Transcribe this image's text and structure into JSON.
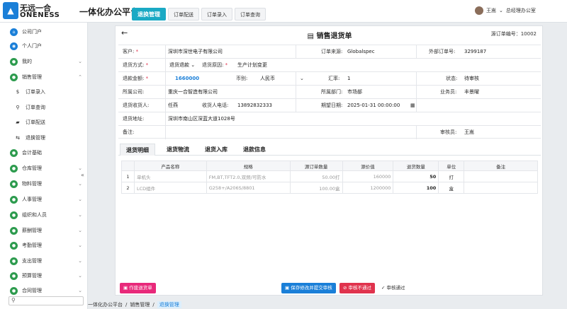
{
  "header": {
    "logo_text": "无远一合",
    "logo_sub": "ONENESS",
    "app_title": "一体化办公平台",
    "tabs": [
      {
        "label": "退换管理",
        "active": true
      },
      {
        "label": "订单配送",
        "active": false
      },
      {
        "label": "订单录入",
        "active": false
      },
      {
        "label": "订单查询",
        "active": false
      }
    ],
    "user_name": "王嵩",
    "user_dept": "总经理办公室"
  },
  "sidebar": {
    "items": [
      {
        "label": "公司门户",
        "icon": "portal-icon"
      },
      {
        "label": "个人门户",
        "icon": "wifi-icon"
      },
      {
        "label": "我的",
        "icon": "location-icon"
      },
      {
        "label": "销售管理",
        "icon": "sales-icon"
      },
      {
        "label": "会计基础",
        "icon": "accounting-icon"
      },
      {
        "label": "仓库管理",
        "icon": "warehouse-icon"
      },
      {
        "label": "物料管理",
        "icon": "material-icon"
      },
      {
        "label": "人事管理",
        "icon": "hr-icon"
      },
      {
        "label": "组织和人员",
        "icon": "org-icon"
      },
      {
        "label": "薪酬管理",
        "icon": "salary-icon"
      },
      {
        "label": "考勤管理",
        "icon": "attendance-icon"
      },
      {
        "label": "支出管理",
        "icon": "expense-icon"
      },
      {
        "label": "预算管理",
        "icon": "budget-icon"
      },
      {
        "label": "合同管理",
        "icon": "contract-icon"
      }
    ],
    "subitems": [
      {
        "label": "订单录入",
        "icon": "dollar-icon"
      },
      {
        "label": "订单查询",
        "icon": "search-icon"
      },
      {
        "label": "订单配送",
        "icon": "truck-icon"
      },
      {
        "label": "退换管理",
        "icon": "exchange-icon"
      }
    ]
  },
  "form": {
    "title": "销售退货单",
    "source_no_label": "源订单编号：",
    "source_no": "10002",
    "customer_label": "客户:",
    "customer": "深圳市深世电子有限公司",
    "order_source_label": "订单来源:",
    "order_source": "Globalspec",
    "ext_order_label": "外部订单号:",
    "ext_order": "3299187",
    "return_method_label": "退货方式:",
    "return_method": "退货退款",
    "return_reason_label": "退货原因:",
    "return_reason": "生产计划变更",
    "refund_label": "退款金额:",
    "refund": "1660000",
    "currency_label": "币别:",
    "currency": "人民币",
    "rate_label": "汇率:",
    "rate": "1",
    "status_label": "状态:",
    "status": "待审核",
    "company_label": "所属公司:",
    "company": "重庆一合智造有限公司",
    "dept_label": "所属部门:",
    "dept": "市场部",
    "salesman_label": "业务员:",
    "salesman": "丰景曜",
    "receiver_label": "退货收货人:",
    "receiver": "任燕",
    "receiver_phone_label": "收货人电话:",
    "receiver_phone": "13892832333",
    "expected_date_label": "期望日期:",
    "expected_date": "2025-01-31 00:00:00",
    "address_label": "退货地址:",
    "address": "深圳市南山区深蓝大道1028号",
    "remark_label": "备注:",
    "auditor_label": "审核员:",
    "auditor": "王嵩"
  },
  "subtabs": [
    "退货明细",
    "退货物流",
    "退货入库",
    "退款信息"
  ],
  "table": {
    "headers": [
      "",
      "产品名称",
      "规格",
      "源订单数量",
      "源价值",
      "退货数量",
      "单位",
      "备注"
    ],
    "rows": [
      {
        "no": "1",
        "name": "单机头",
        "spec": "FM,BT,TFT2.0,双频/可防水",
        "src_qty": "50.00打",
        "src_value": "160000",
        "ret_qty": "50",
        "unit": "打",
        "remark": ""
      },
      {
        "no": "2",
        "name": "LCD组件",
        "spec": "G258+/A206S/8801",
        "src_qty": "100.00盒",
        "src_value": "1200000",
        "ret_qty": "100",
        "unit": "盒",
        "remark": ""
      }
    ]
  },
  "buttons": {
    "void": "作废退货单",
    "save_submit": "保存修改并提交审核",
    "reject": "审核不通过",
    "approve": "审核通过"
  },
  "breadcrumb": [
    "一体化办公平台",
    "销售管理",
    "退换管理"
  ]
}
